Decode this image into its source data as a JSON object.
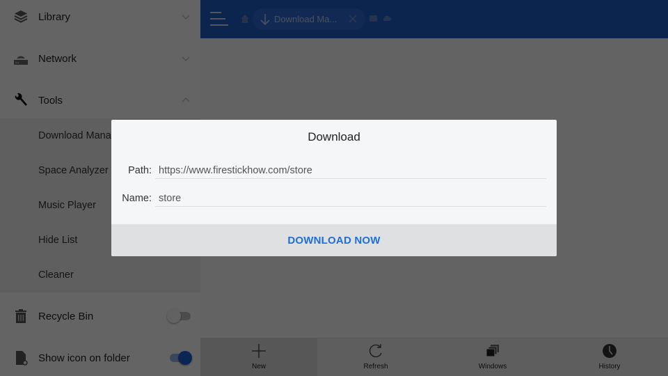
{
  "sidebar": {
    "sections": [
      {
        "label": "Library",
        "icon": "layers-icon",
        "expanded": false
      },
      {
        "label": "Network",
        "icon": "router-icon",
        "expanded": false
      },
      {
        "label": "Tools",
        "icon": "wrench-icon",
        "expanded": true
      }
    ],
    "tools_items": [
      {
        "label": "Download Manager"
      },
      {
        "label": "Space Analyzer"
      },
      {
        "label": "Music Player"
      },
      {
        "label": "Hide List"
      },
      {
        "label": "Cleaner"
      }
    ],
    "settings": [
      {
        "label": "Recycle Bin",
        "icon": "trash-icon",
        "enabled": false
      },
      {
        "label": "Show icon on folder",
        "icon": "folder-icon",
        "enabled": true
      }
    ]
  },
  "topbar": {
    "active_tab_label": "Download Ma...",
    "colors": {
      "bar": "#1f5cc4"
    }
  },
  "bottombar": {
    "buttons": [
      {
        "label": "New",
        "icon": "plus-icon",
        "active": true
      },
      {
        "label": "Refresh",
        "icon": "refresh-icon",
        "active": false
      },
      {
        "label": "Windows",
        "icon": "windows-icon",
        "active": false
      },
      {
        "label": "History",
        "icon": "clock-icon",
        "active": false
      }
    ]
  },
  "dialog": {
    "title": "Download",
    "path_label": "Path:",
    "path_value": "https://www.firestickhow.com/store",
    "name_label": "Name:",
    "name_value": "store",
    "action_label": "DOWNLOAD NOW",
    "colors": {
      "action": "#1e6fd9"
    }
  }
}
